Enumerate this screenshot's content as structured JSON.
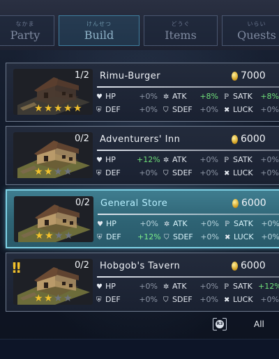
{
  "tabs": [
    {
      "jp": "なかま",
      "label": "Party",
      "active": false
    },
    {
      "jp": "けんせつ",
      "label": "Build",
      "active": true
    },
    {
      "jp": "どうぐ",
      "label": "Items",
      "active": false
    },
    {
      "jp": "いらい",
      "label": "Quests",
      "active": false
    }
  ],
  "buildings": [
    {
      "name": "Rimu-Burger",
      "count": "1/2",
      "price": "7000",
      "stars": 5,
      "max_stars": 5,
      "selected": false,
      "alert": false,
      "stats": {
        "hp": "+0%",
        "atk": "+8%",
        "satk": "+8%",
        "def": "+0%",
        "sdef": "+0%",
        "luck": "+0%"
      }
    },
    {
      "name": "Adventurers' Inn",
      "count": "0/2",
      "price": "6000",
      "stars": 2,
      "max_stars": 4,
      "selected": false,
      "alert": false,
      "stats": {
        "hp": "+12%",
        "atk": "+0%",
        "satk": "+0%",
        "def": "+0%",
        "sdef": "+0%",
        "luck": "+0%"
      }
    },
    {
      "name": "General Store",
      "count": "0/2",
      "price": "6000",
      "stars": 2,
      "max_stars": 4,
      "selected": true,
      "alert": false,
      "stats": {
        "hp": "+0%",
        "atk": "+0%",
        "satk": "+0%",
        "def": "+12%",
        "sdef": "+0%",
        "luck": "+0%"
      }
    },
    {
      "name": "Hobgob's Tavern",
      "count": "0/2",
      "price": "6000",
      "stars": 2,
      "max_stars": 4,
      "selected": false,
      "alert": true,
      "stats": {
        "hp": "+0%",
        "atk": "+0%",
        "satk": "+12%",
        "def": "+0%",
        "sdef": "+0%",
        "luck": "+0%"
      }
    }
  ],
  "stat_labels": {
    "hp": "HP",
    "atk": "ATK",
    "satk": "SATK",
    "def": "DEF",
    "sdef": "SDEF",
    "luck": "LUCK"
  },
  "alert_mark": "!!",
  "footer": {
    "button_glyph": "R3",
    "label": "All"
  },
  "colors": {
    "selected_accent": "#7fd2e6",
    "positive": "#6fe07a",
    "star": "#f2c12c"
  }
}
